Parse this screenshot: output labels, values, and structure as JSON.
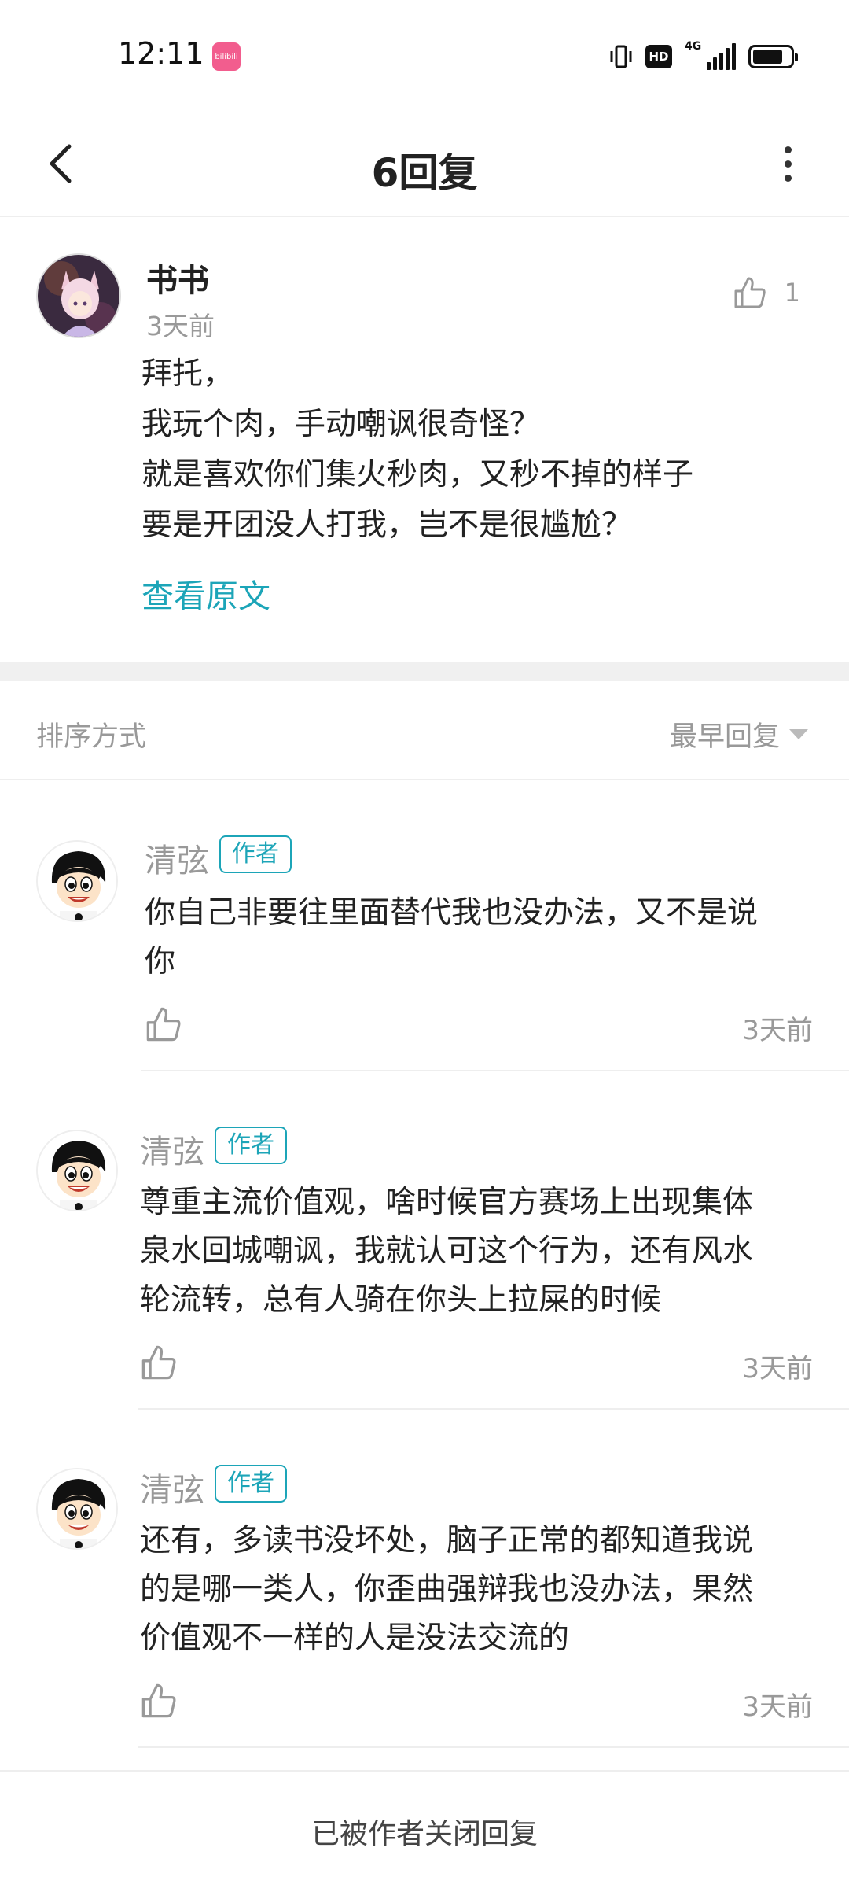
{
  "status_bar": {
    "time": "12:11",
    "app_badge": "bilibili",
    "network": "4G",
    "hd_label": "HD"
  },
  "nav": {
    "title": "6回复"
  },
  "original_comment": {
    "username": "书书",
    "time": "3天前",
    "like_count": "1",
    "lines": [
      "拜托，",
      "我玩个肉，手动嘲讽很奇怪？",
      "就是喜欢你们集火秒肉，又秒不掉的样子",
      "要是开团没人打我，岂不是很尴尬？"
    ],
    "view_original_label": "查看原文"
  },
  "sort": {
    "label": "排序方式",
    "selected": "最早回复"
  },
  "replies": [
    {
      "username": "清弦",
      "tag": "作者",
      "lines": [
        "你自己非要往里面替代我也没办法，又不是说",
        "你"
      ],
      "time": "3天前"
    },
    {
      "username": "清弦",
      "tag": "作者",
      "lines": [
        "尊重主流价值观，啥时候官方赛场上出现集体",
        "泉水回城嘲讽，我就认可这个行为，还有风水",
        "轮流转，总有人骑在你头上拉屎的时候"
      ],
      "time": "3天前"
    },
    {
      "username": "清弦",
      "tag": "作者",
      "lines": [
        "还有，多读书没坏处，脑子正常的都知道我说",
        "的是哪一类人，你歪曲强辩我也没办法，果然",
        "价值观不一样的人是没法交流的"
      ],
      "time": "3天前"
    }
  ],
  "footer": {
    "text": "已被作者关闭回复"
  },
  "colors": {
    "accent": "#1ca5b8",
    "muted": "#999999",
    "brand_pink": "#f25d8e"
  }
}
